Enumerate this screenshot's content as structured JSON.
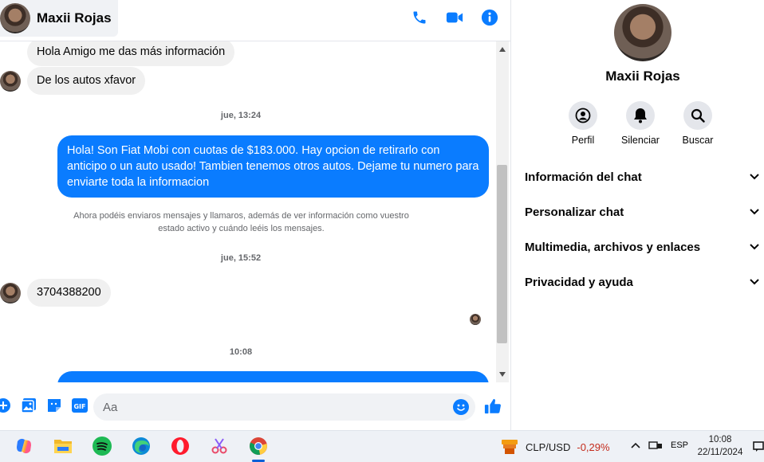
{
  "header": {
    "contact_name": "Maxii Rojas",
    "actions": [
      "phone-icon",
      "video-icon",
      "info-icon"
    ]
  },
  "messages": [
    {
      "type": "incoming",
      "text": "Hola Amigo me das más información"
    },
    {
      "type": "incoming",
      "text": "De los autos xfavor"
    },
    {
      "type": "timestamp",
      "text": "jue, 13:24"
    },
    {
      "type": "outgoing",
      "text": "Hola! Son Fiat Mobi con cuotas de $183.000. Hay opcion de retirarlo con anticipo o un auto usado! Tambien tenemos otros autos. Dejame tu numero para enviarte toda la informacion"
    },
    {
      "type": "system",
      "text": "Ahora podéis enviaros mensajes y llamaros, además de ver información como vuestro estado activo y cuándo leéis los mensajes."
    },
    {
      "type": "timestamp",
      "text": "jue, 15:52"
    },
    {
      "type": "incoming",
      "text": "3704388200"
    },
    {
      "type": "timestamp",
      "text": "10:08"
    }
  ],
  "composer": {
    "placeholder": "Aa",
    "gif_label": "GIF"
  },
  "info_panel": {
    "name": "Maxii Rojas",
    "actions": [
      {
        "label": "Perfil",
        "icon": "profile-icon"
      },
      {
        "label": "Silenciar",
        "icon": "bell-icon"
      },
      {
        "label": "Buscar",
        "icon": "search-icon"
      }
    ],
    "sections": [
      "Información del chat",
      "Personalizar chat",
      "Multimedia, archivos y enlaces",
      "Privacidad y ayuda"
    ]
  },
  "taskbar": {
    "apps": [
      "copilot-icon",
      "file-explorer-icon",
      "spotify-icon",
      "edge-icon",
      "opera-icon",
      "snipping-tool-icon",
      "chrome-icon"
    ],
    "ticker_pair": "CLP/USD",
    "ticker_change": "-0,29%",
    "language": "ESP",
    "time": "10:08",
    "date": "22/11/2024"
  },
  "colors": {
    "messenger_blue": "#0a7cff",
    "incoming_bubble": "#f0f0f0",
    "muted_text": "#65676b",
    "negative": "#c42b1c"
  }
}
